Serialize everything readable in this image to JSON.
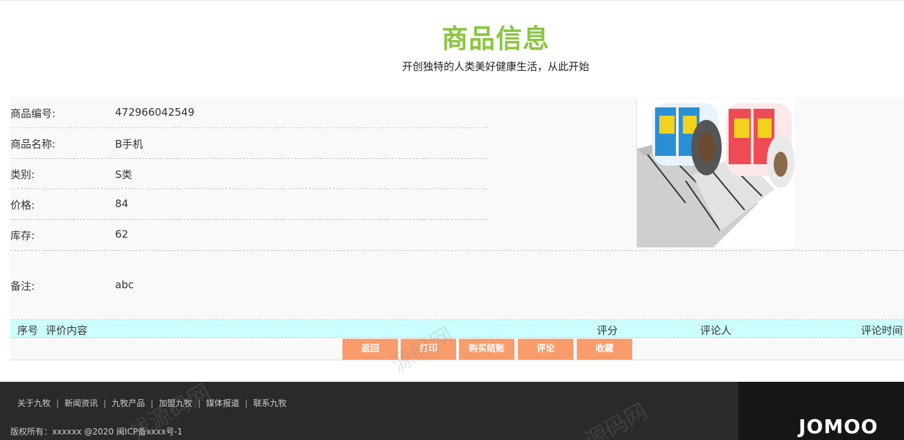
{
  "header": {
    "title": "商品信息",
    "subtitle": "开创独特的人类美好健康生活，从此开始"
  },
  "product": {
    "fields": [
      {
        "label": "商品编号:",
        "value": "472966042549"
      },
      {
        "label": "商品名称:",
        "value": "B手机"
      },
      {
        "label": "类别:",
        "value": "S类"
      },
      {
        "label": "价格:",
        "value": "84"
      },
      {
        "label": "库存:",
        "value": "62"
      }
    ],
    "remark_label": "备注:",
    "remark_value": "abc"
  },
  "reviews": {
    "columns": [
      "序号",
      "评价内容",
      "评分",
      "评论人",
      "评论时间"
    ]
  },
  "actions": [
    "返回",
    "打印",
    "购买结账",
    "评论",
    "收藏"
  ],
  "footer": {
    "links": [
      "关于九牧",
      "新闻资讯",
      "九牧产品",
      "加盟九牧",
      "媒体报道",
      "联系九牧"
    ],
    "separator": "|",
    "copyright": "版权所有：xxxxxx @2020 闽ICP备xxxx号-1",
    "logo": "JOMOO"
  },
  "watermarks": [
    "源码网",
    "找源码网",
    "源码网"
  ],
  "colors": {
    "title": "#8cc63f",
    "button": "#fa9b6b",
    "review_header_bg": "#ccffff",
    "footer_bg": "#2a2a2a",
    "footer_logo_bg": "#161616"
  }
}
